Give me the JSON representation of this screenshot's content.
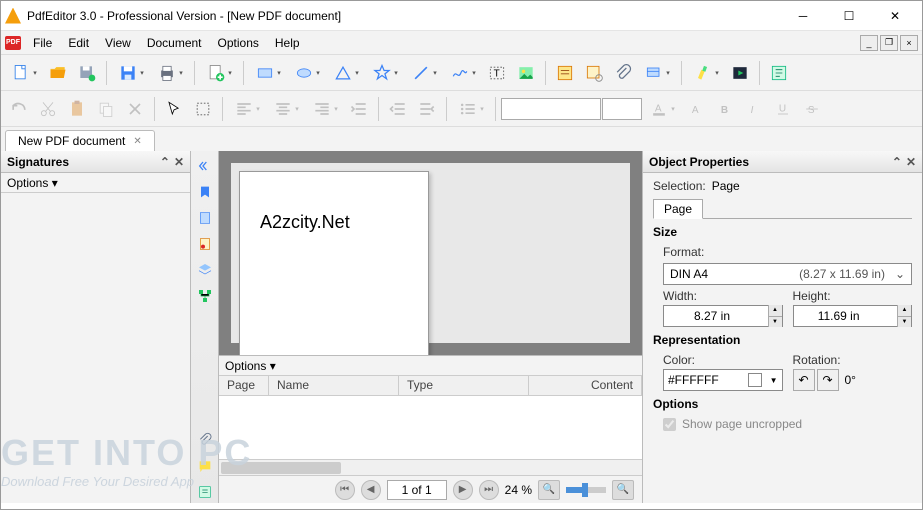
{
  "window": {
    "title": "PdfEditor 3.0 - Professional Version - [New PDF document]"
  },
  "menu": {
    "file": "File",
    "edit": "Edit",
    "view": "View",
    "document": "Document",
    "options": "Options",
    "help": "Help"
  },
  "doc_tab": {
    "label": "New PDF document"
  },
  "signatures": {
    "title": "Signatures",
    "options": "Options ▾"
  },
  "page_content": {
    "text": "A2zcity.Net"
  },
  "bottom_panel": {
    "options": "Options ▾",
    "cols": {
      "page": "Page",
      "name": "Name",
      "type": "Type",
      "content": "Content"
    }
  },
  "statusbar": {
    "page": "1 of 1",
    "zoom": "24 %"
  },
  "props": {
    "title": "Object Properties",
    "selection_label": "Selection:",
    "selection_value": "Page",
    "tab_page": "Page",
    "size_section": "Size",
    "format_label": "Format:",
    "format_value": "DIN A4",
    "format_dims": "(8.27 x 11.69 in)",
    "width_label": "Width:",
    "width_value": "8.27 in",
    "height_label": "Height:",
    "height_value": "11.69 in",
    "repr_section": "Representation",
    "color_label": "Color:",
    "color_value": "#FFFFFF",
    "rotation_label": "Rotation:",
    "rotation_value": "0°",
    "options_section": "Options",
    "show_uncropped": "Show page uncropped"
  },
  "watermark": {
    "big": "GET INTO PC",
    "sub": "Download Free Your Desired App"
  }
}
